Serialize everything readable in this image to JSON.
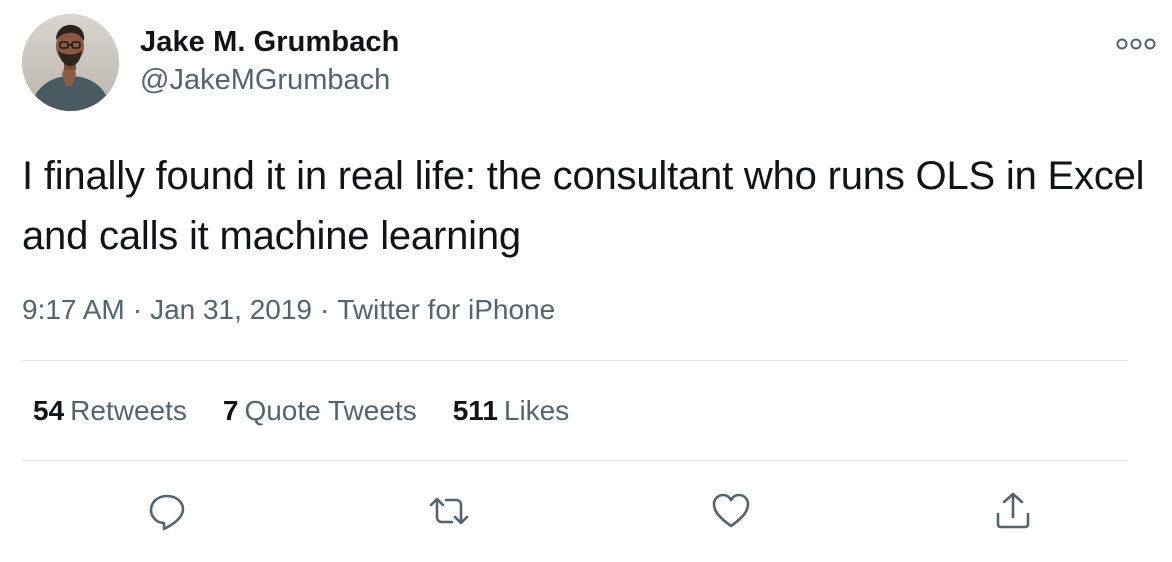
{
  "author": {
    "name": "Jake M. Grumbach",
    "handle": "@JakeMGrumbach"
  },
  "tweet": {
    "text": "I finally found it in real life: the consultant who runs OLS in Excel and calls it machine learning",
    "time": "9:17 AM",
    "date": "Jan 31, 2019",
    "source": "Twitter for iPhone",
    "separator": "·"
  },
  "stats": {
    "retweets": {
      "count": "54",
      "label": "Retweets"
    },
    "quote_tweets": {
      "count": "7",
      "label": "Quote Tweets"
    },
    "likes": {
      "count": "511",
      "label": "Likes"
    }
  },
  "actions": {
    "reply": "reply-icon",
    "retweet": "retweet-icon",
    "like": "heart-icon",
    "share": "share-icon",
    "more": "more-options-icon"
  },
  "colors": {
    "text": "#0f1419",
    "secondary": "#536471",
    "divider": "#e1e8ed"
  }
}
